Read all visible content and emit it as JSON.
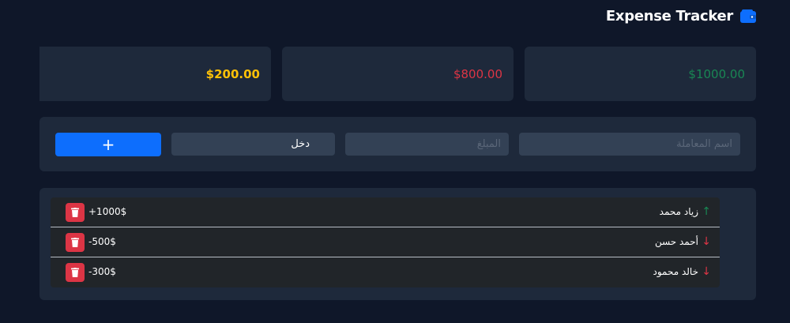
{
  "header": {
    "title": "Expense Tracker",
    "icon": "wallet-icon",
    "icon_color": "#0d6efd"
  },
  "summary": {
    "balance": "$200.00",
    "expense": "$800.00",
    "income": "$1000.00"
  },
  "form": {
    "add_label": "+",
    "type_value": "دخل",
    "amount_placeholder": "المبلغ",
    "name_placeholder": "اسم المعاملة"
  },
  "transactions": [
    {
      "name": "زياد محمد",
      "amount": "+1000$",
      "direction": "up"
    },
    {
      "name": "أحمد حسن",
      "amount": "-500$",
      "direction": "down"
    },
    {
      "name": "خالد محمود",
      "amount": "-300$",
      "direction": "down"
    }
  ],
  "colors": {
    "background": "#0f1729",
    "panel": "#1e293b",
    "primary": "#0d6efd",
    "danger": "#dc3545",
    "success": "#198754",
    "warning": "#ffc107"
  }
}
